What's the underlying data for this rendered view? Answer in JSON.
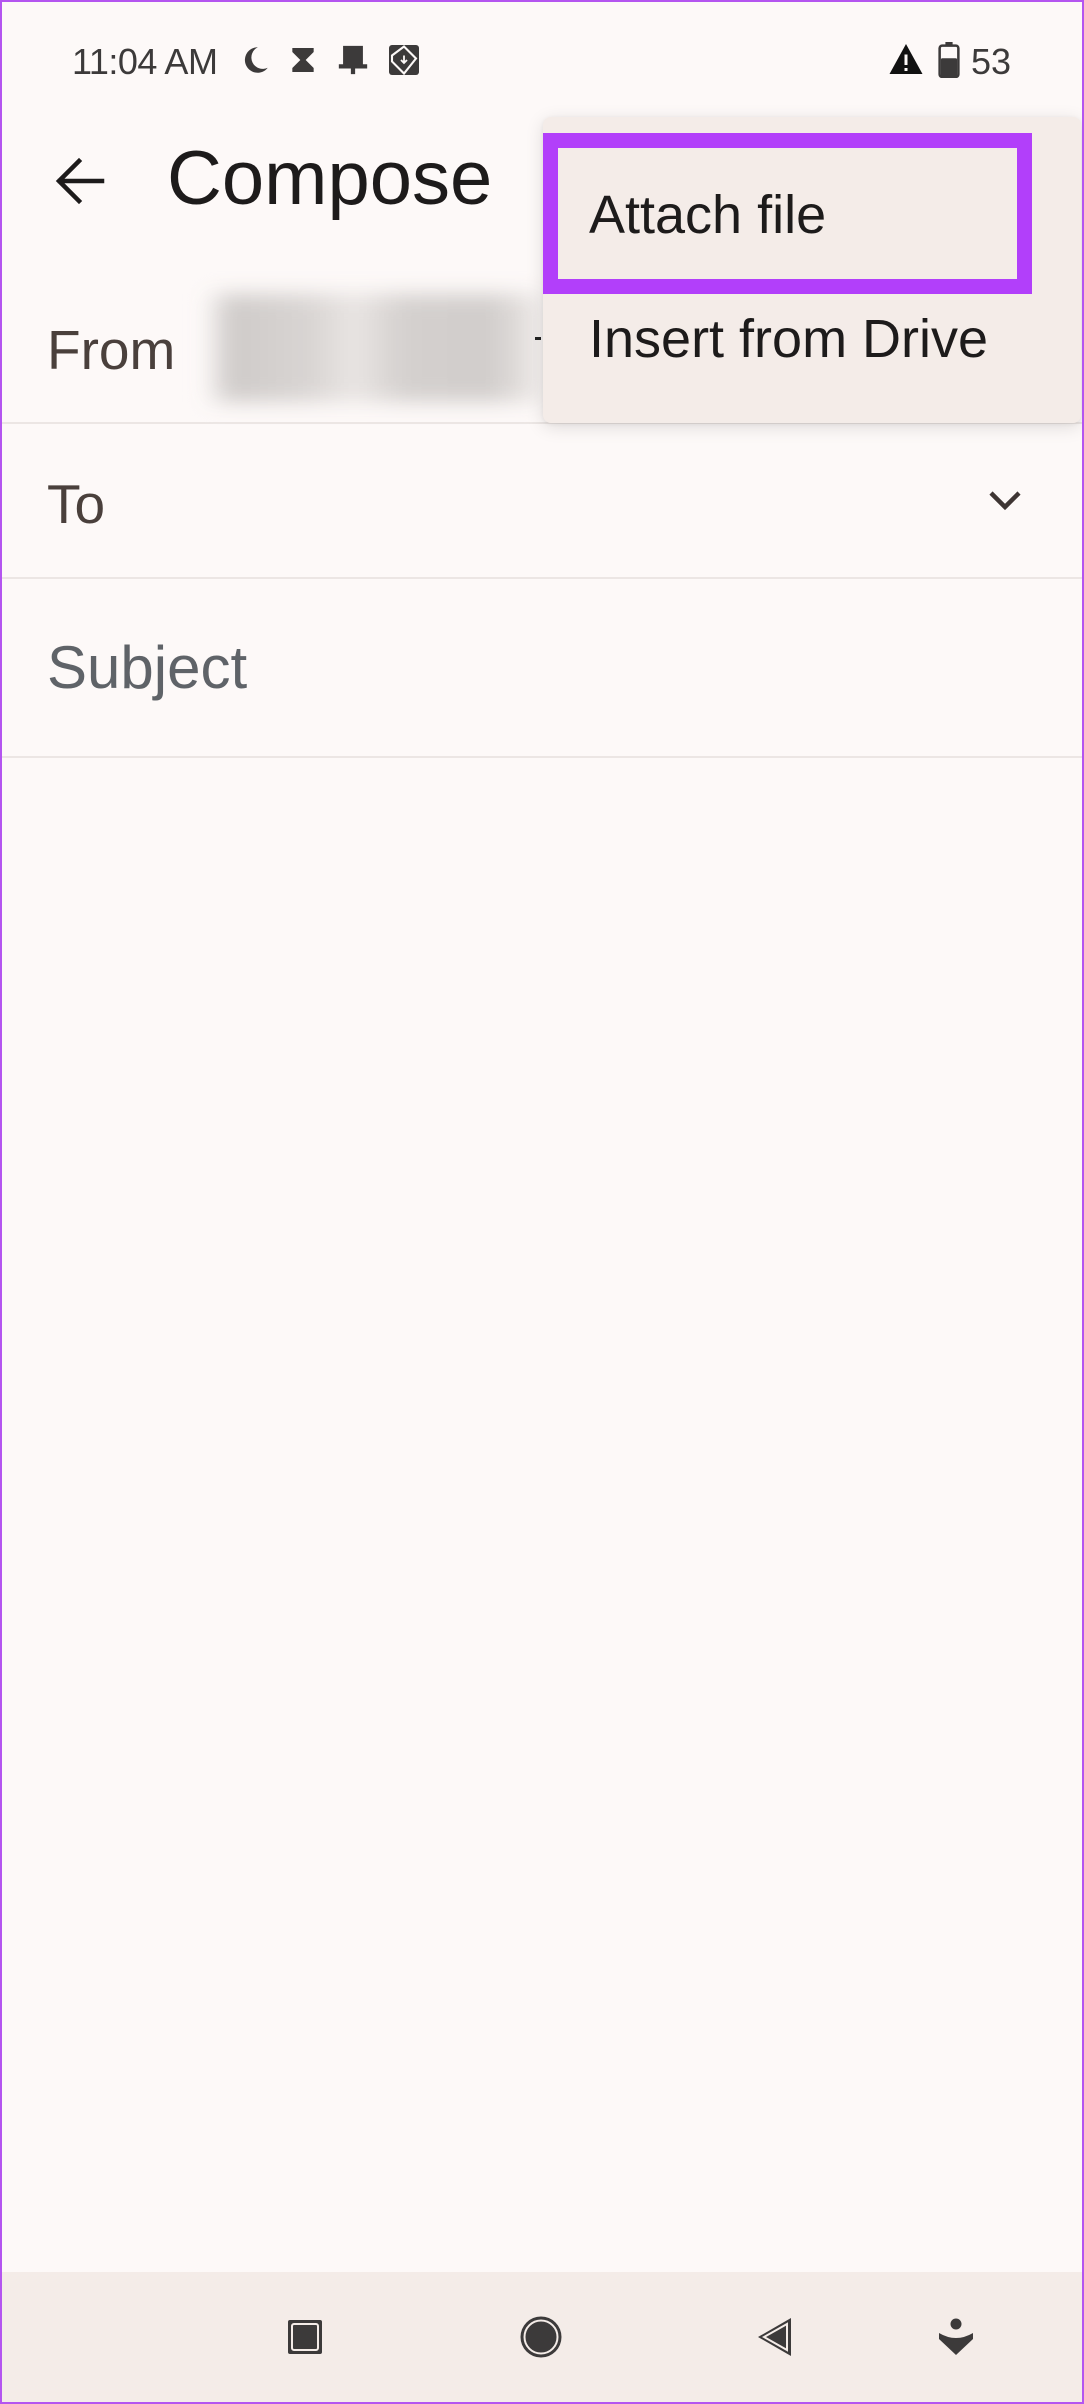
{
  "status_bar": {
    "time": "11:04 AM",
    "left_icons": [
      "do-not-disturb-moon-icon",
      "hourglass-icon",
      "pin-notification-icon",
      "download-image-icon"
    ],
    "right_icons": [
      "warning-icon",
      "battery-icon"
    ],
    "battery_percent": "53",
    "battery_level": 0.53
  },
  "header": {
    "back_icon": "arrow-left-icon",
    "title": "Compose"
  },
  "form": {
    "from_label": "From",
    "from_value_redacted": true,
    "to_label": "To",
    "to_expand_icon": "chevron-down-icon",
    "subject_placeholder": "Subject",
    "subject_value": ""
  },
  "attach_menu": {
    "items": [
      {
        "label": "Attach file",
        "highlighted": true
      },
      {
        "label": "Insert from Drive",
        "highlighted": false
      }
    ],
    "highlight_color": "#b23ffa"
  },
  "nav_bar": {
    "buttons": [
      {
        "name": "recents",
        "icon": "square-icon"
      },
      {
        "name": "home",
        "icon": "circle-icon"
      },
      {
        "name": "back",
        "icon": "triangle-back-icon"
      },
      {
        "name": "accessibility",
        "icon": "accessibility-icon"
      }
    ]
  },
  "colors": {
    "background": "#fdf9f8",
    "surface": "#f4ece8",
    "annotation": "#b23ffa",
    "text_primary": "#1d1b1b",
    "text_label": "#4a403c",
    "text_placeholder": "#5f6368"
  }
}
